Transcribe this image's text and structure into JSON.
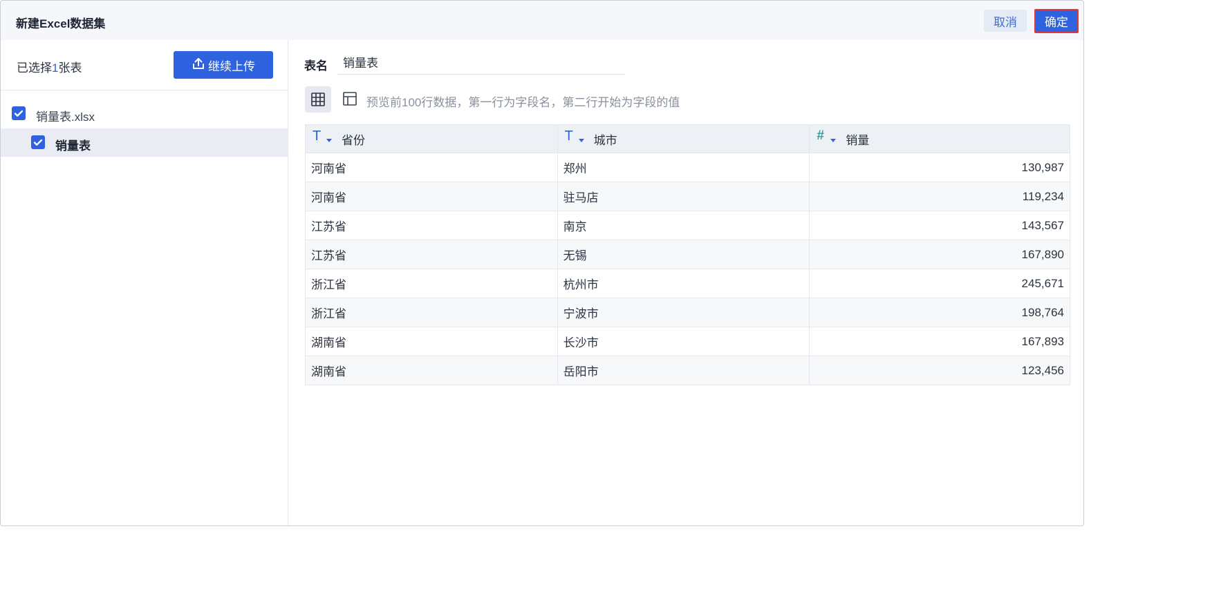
{
  "dialog": {
    "title": "新建Excel数据集",
    "cancel_label": "取消",
    "confirm_label": "确定"
  },
  "left_panel": {
    "selected_prefix": "已选择",
    "selected_count": "1",
    "selected_suffix": "张表",
    "upload_label": "继续上传",
    "file": {
      "name": "销量表.xlsx",
      "checked": true
    },
    "sheet": {
      "name": "销量表",
      "checked": true
    }
  },
  "right_panel": {
    "table_name_label": "表名",
    "table_name_value": "销量表",
    "hint": "预览前100行数据，第一行为字段名，第二行开始为字段的值",
    "columns": [
      {
        "type": "text",
        "type_icon": "T",
        "label": "省份"
      },
      {
        "type": "text",
        "type_icon": "T",
        "label": "城市"
      },
      {
        "type": "number",
        "type_icon": "#",
        "label": "销量"
      }
    ],
    "rows": [
      [
        "河南省",
        "郑州",
        "130,987"
      ],
      [
        "河南省",
        "驻马店",
        "119,234"
      ],
      [
        "江苏省",
        "南京",
        "143,567"
      ],
      [
        "江苏省",
        "无锡",
        "167,890"
      ],
      [
        "浙江省",
        "杭州市",
        "245,671"
      ],
      [
        "浙江省",
        "宁波市",
        "198,764"
      ],
      [
        "湖南省",
        "长沙市",
        "167,893"
      ],
      [
        "湖南省",
        "岳阳市",
        "123,456"
      ]
    ]
  },
  "colors": {
    "accent": "#2f62de",
    "confirm_border": "#e0353f",
    "number_type": "#26a69a"
  }
}
